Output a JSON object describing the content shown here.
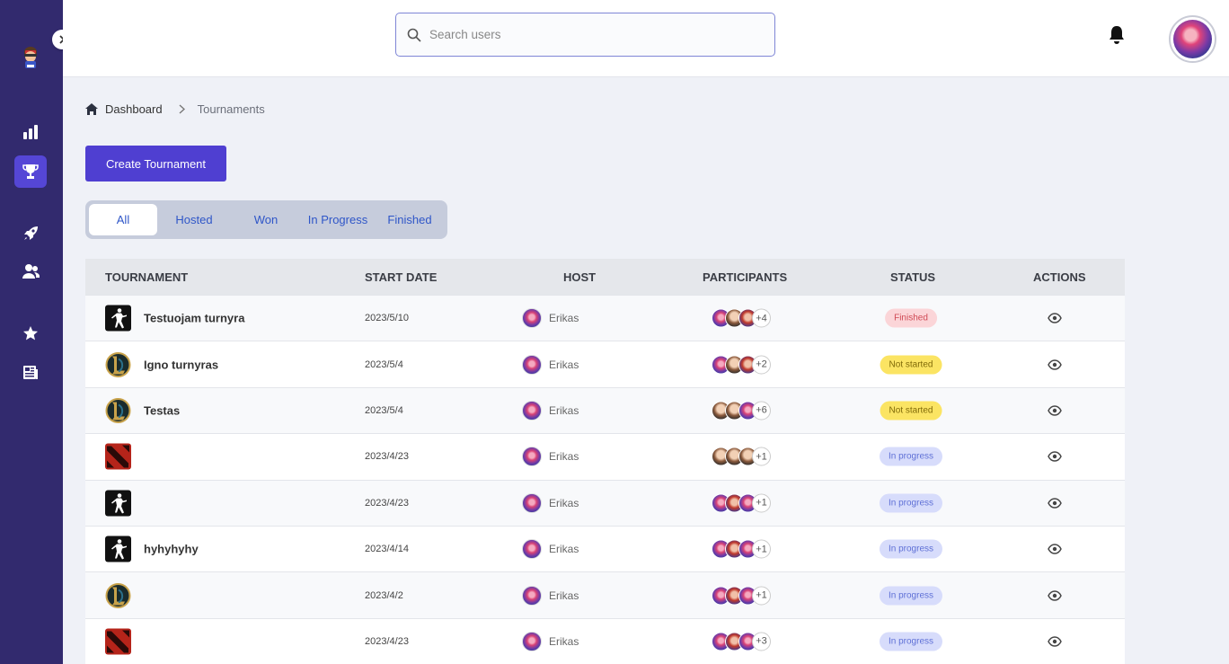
{
  "app": {
    "logo_icon": "gamer-mascot-logo",
    "accent": "#4f3fd1",
    "sidebar_color": "#322a6e"
  },
  "sidebar": {
    "items": [
      {
        "name": "stats",
        "icon": "bar-chart-icon"
      },
      {
        "name": "tournaments",
        "icon": "trophy-icon",
        "active": true
      },
      {
        "name": "launch",
        "icon": "rocket-icon"
      },
      {
        "name": "users",
        "icon": "users-icon"
      },
      {
        "name": "favorites",
        "icon": "star-icon"
      },
      {
        "name": "news",
        "icon": "newspaper-icon"
      }
    ]
  },
  "header": {
    "search_placeholder": "Search users"
  },
  "breadcrumb": {
    "home": "Dashboard",
    "current": "Tournaments"
  },
  "create_button": "Create Tournament",
  "tabs": [
    "All",
    "Hosted",
    "Won",
    "In Progress",
    "Finished"
  ],
  "table": {
    "columns": [
      "TOURNAMENT",
      "START DATE",
      "HOST",
      "PARTICIPANTS",
      "STATUS",
      "ACTIONS"
    ],
    "rows": [
      {
        "game": "csgo",
        "name": "Testuojam turnyra",
        "date": "2023/5/10",
        "host": "Erikas",
        "avatars": [
          "a",
          "b",
          "c"
        ],
        "more": "+4",
        "status": "Finished",
        "status_kind": "finished"
      },
      {
        "game": "lol",
        "name": "Igno turnyras",
        "date": "2023/5/4",
        "host": "Erikas",
        "avatars": [
          "a",
          "b",
          "c"
        ],
        "more": "+2",
        "status": "Not started",
        "status_kind": "notstarted"
      },
      {
        "game": "lol",
        "name": "Testas",
        "date": "2023/5/4",
        "host": "Erikas",
        "avatars": [
          "b",
          "b",
          "a"
        ],
        "more": "+6",
        "status": "Not started",
        "status_kind": "notstarted"
      },
      {
        "game": "dota",
        "name": "",
        "date": "2023/4/23",
        "host": "Erikas",
        "avatars": [
          "b",
          "b",
          "b"
        ],
        "more": "+1",
        "status": "In progress",
        "status_kind": "inprogress"
      },
      {
        "game": "csgo",
        "name": "",
        "date": "2023/4/23",
        "host": "Erikas",
        "avatars": [
          "a",
          "c",
          "a"
        ],
        "more": "+1",
        "status": "In progress",
        "status_kind": "inprogress"
      },
      {
        "game": "csgo",
        "name": "hyhyhyhy",
        "date": "2023/4/14",
        "host": "Erikas",
        "avatars": [
          "a",
          "c",
          "a"
        ],
        "more": "+1",
        "status": "In progress",
        "status_kind": "inprogress"
      },
      {
        "game": "lol",
        "name": "",
        "date": "2023/4/2",
        "host": "Erikas",
        "avatars": [
          "a",
          "c",
          "a"
        ],
        "more": "+1",
        "status": "In progress",
        "status_kind": "inprogress"
      },
      {
        "game": "dota",
        "name": "",
        "date": "2023/4/23",
        "host": "Erikas",
        "avatars": [
          "a",
          "c",
          "a"
        ],
        "more": "+3",
        "status": "In progress",
        "status_kind": "inprogress"
      }
    ]
  }
}
